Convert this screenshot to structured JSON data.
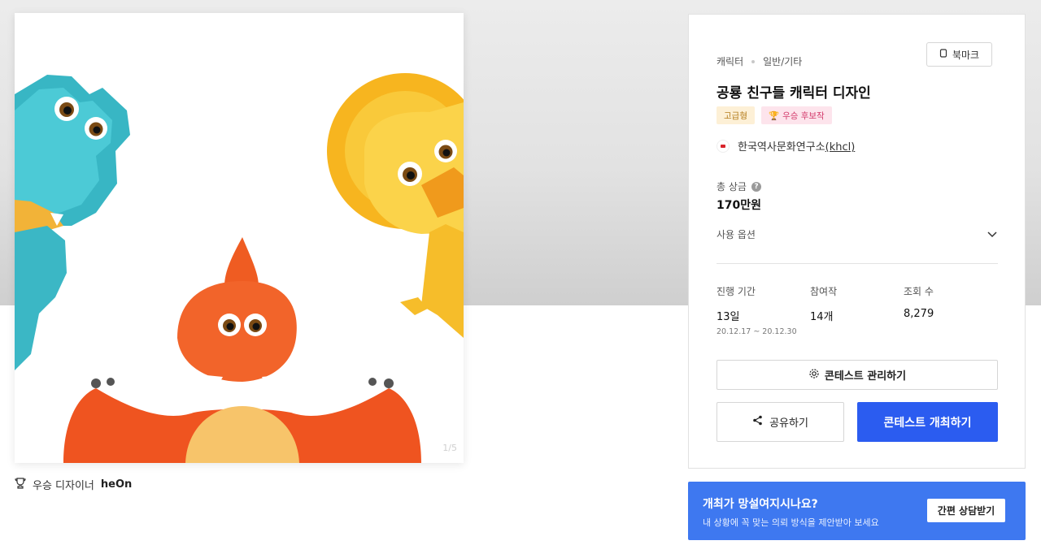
{
  "artwork": {
    "page_indicator": "1/5",
    "winner_prefix": "우승 디자이너",
    "winner_name": "heOn"
  },
  "contest": {
    "category": "캐릭터",
    "subcategory": "일반/기타",
    "bookmark_label": "북마크",
    "title": "공룡 친구들 캐릭터 디자인",
    "badges": [
      "고급형",
      "우승 후보작"
    ],
    "host_name": "한국역사문화연구소",
    "host_id": "(khcl)",
    "prize_label": "총 상금",
    "prize_value": "170만원",
    "usage_label": "사용 옵션",
    "stats": {
      "period_label": "진행 기간",
      "period_value": "13일",
      "period_range": "20.12.17 ~ 20.12.30",
      "entries_label": "참여작",
      "entries_value": "14개",
      "views_label": "조회 수",
      "views_value": "8,279"
    },
    "manage_button": "콘테스트 관리하기",
    "share_button": "공유하기",
    "host_button": "콘테스트 개최하기"
  },
  "promo": {
    "headline": "개최가 망설여지시나요?",
    "subtext": "내 상황에 꼭 맞는 의뢰 방식을 제안받아 보세요",
    "button": "간편 상담받기"
  },
  "colors": {
    "primary": "#2b5cf0",
    "promo_bg": "#3e78f0",
    "badge_gold_bg": "#fdf0d6",
    "badge_pink_bg": "#fde4ec"
  },
  "icons": [
    "trophy-icon",
    "bookmark-icon",
    "help-icon",
    "chevron-down-icon",
    "gear-icon",
    "share-icon"
  ]
}
